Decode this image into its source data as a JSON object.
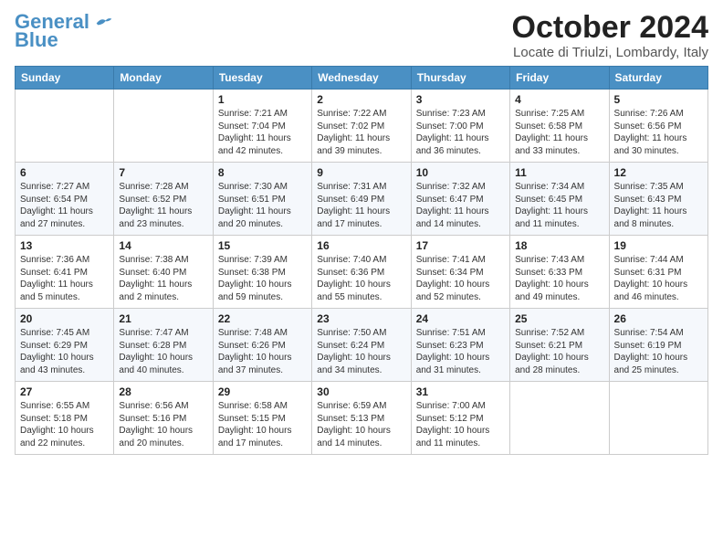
{
  "header": {
    "logo_line1": "General",
    "logo_line2": "Blue",
    "month_title": "October 2024",
    "location": "Locate di Triulzi, Lombardy, Italy"
  },
  "columns": [
    "Sunday",
    "Monday",
    "Tuesday",
    "Wednesday",
    "Thursday",
    "Friday",
    "Saturday"
  ],
  "weeks": [
    [
      {
        "day": "",
        "info": ""
      },
      {
        "day": "",
        "info": ""
      },
      {
        "day": "1",
        "info": "Sunrise: 7:21 AM\nSunset: 7:04 PM\nDaylight: 11 hours and 42 minutes."
      },
      {
        "day": "2",
        "info": "Sunrise: 7:22 AM\nSunset: 7:02 PM\nDaylight: 11 hours and 39 minutes."
      },
      {
        "day": "3",
        "info": "Sunrise: 7:23 AM\nSunset: 7:00 PM\nDaylight: 11 hours and 36 minutes."
      },
      {
        "day": "4",
        "info": "Sunrise: 7:25 AM\nSunset: 6:58 PM\nDaylight: 11 hours and 33 minutes."
      },
      {
        "day": "5",
        "info": "Sunrise: 7:26 AM\nSunset: 6:56 PM\nDaylight: 11 hours and 30 minutes."
      }
    ],
    [
      {
        "day": "6",
        "info": "Sunrise: 7:27 AM\nSunset: 6:54 PM\nDaylight: 11 hours and 27 minutes."
      },
      {
        "day": "7",
        "info": "Sunrise: 7:28 AM\nSunset: 6:52 PM\nDaylight: 11 hours and 23 minutes."
      },
      {
        "day": "8",
        "info": "Sunrise: 7:30 AM\nSunset: 6:51 PM\nDaylight: 11 hours and 20 minutes."
      },
      {
        "day": "9",
        "info": "Sunrise: 7:31 AM\nSunset: 6:49 PM\nDaylight: 11 hours and 17 minutes."
      },
      {
        "day": "10",
        "info": "Sunrise: 7:32 AM\nSunset: 6:47 PM\nDaylight: 11 hours and 14 minutes."
      },
      {
        "day": "11",
        "info": "Sunrise: 7:34 AM\nSunset: 6:45 PM\nDaylight: 11 hours and 11 minutes."
      },
      {
        "day": "12",
        "info": "Sunrise: 7:35 AM\nSunset: 6:43 PM\nDaylight: 11 hours and 8 minutes."
      }
    ],
    [
      {
        "day": "13",
        "info": "Sunrise: 7:36 AM\nSunset: 6:41 PM\nDaylight: 11 hours and 5 minutes."
      },
      {
        "day": "14",
        "info": "Sunrise: 7:38 AM\nSunset: 6:40 PM\nDaylight: 11 hours and 2 minutes."
      },
      {
        "day": "15",
        "info": "Sunrise: 7:39 AM\nSunset: 6:38 PM\nDaylight: 10 hours and 59 minutes."
      },
      {
        "day": "16",
        "info": "Sunrise: 7:40 AM\nSunset: 6:36 PM\nDaylight: 10 hours and 55 minutes."
      },
      {
        "day": "17",
        "info": "Sunrise: 7:41 AM\nSunset: 6:34 PM\nDaylight: 10 hours and 52 minutes."
      },
      {
        "day": "18",
        "info": "Sunrise: 7:43 AM\nSunset: 6:33 PM\nDaylight: 10 hours and 49 minutes."
      },
      {
        "day": "19",
        "info": "Sunrise: 7:44 AM\nSunset: 6:31 PM\nDaylight: 10 hours and 46 minutes."
      }
    ],
    [
      {
        "day": "20",
        "info": "Sunrise: 7:45 AM\nSunset: 6:29 PM\nDaylight: 10 hours and 43 minutes."
      },
      {
        "day": "21",
        "info": "Sunrise: 7:47 AM\nSunset: 6:28 PM\nDaylight: 10 hours and 40 minutes."
      },
      {
        "day": "22",
        "info": "Sunrise: 7:48 AM\nSunset: 6:26 PM\nDaylight: 10 hours and 37 minutes."
      },
      {
        "day": "23",
        "info": "Sunrise: 7:50 AM\nSunset: 6:24 PM\nDaylight: 10 hours and 34 minutes."
      },
      {
        "day": "24",
        "info": "Sunrise: 7:51 AM\nSunset: 6:23 PM\nDaylight: 10 hours and 31 minutes."
      },
      {
        "day": "25",
        "info": "Sunrise: 7:52 AM\nSunset: 6:21 PM\nDaylight: 10 hours and 28 minutes."
      },
      {
        "day": "26",
        "info": "Sunrise: 7:54 AM\nSunset: 6:19 PM\nDaylight: 10 hours and 25 minutes."
      }
    ],
    [
      {
        "day": "27",
        "info": "Sunrise: 6:55 AM\nSunset: 5:18 PM\nDaylight: 10 hours and 22 minutes."
      },
      {
        "day": "28",
        "info": "Sunrise: 6:56 AM\nSunset: 5:16 PM\nDaylight: 10 hours and 20 minutes."
      },
      {
        "day": "29",
        "info": "Sunrise: 6:58 AM\nSunset: 5:15 PM\nDaylight: 10 hours and 17 minutes."
      },
      {
        "day": "30",
        "info": "Sunrise: 6:59 AM\nSunset: 5:13 PM\nDaylight: 10 hours and 14 minutes."
      },
      {
        "day": "31",
        "info": "Sunrise: 7:00 AM\nSunset: 5:12 PM\nDaylight: 10 hours and 11 minutes."
      },
      {
        "day": "",
        "info": ""
      },
      {
        "day": "",
        "info": ""
      }
    ]
  ]
}
